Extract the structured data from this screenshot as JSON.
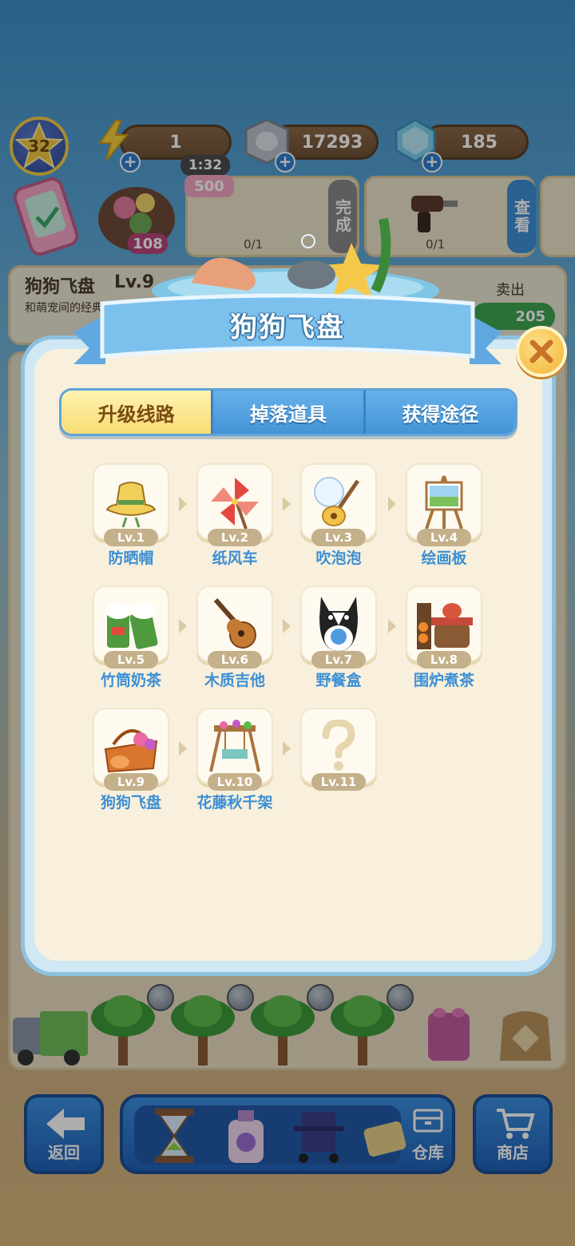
{
  "hud": {
    "player_level": "32",
    "energy": "1",
    "energy_timer": "1:32",
    "coins": "17293",
    "gems": "185"
  },
  "background": {
    "order_badge": "500",
    "order_count_1": "0/1",
    "order_count_2": "0/1",
    "order_complete_label": "完成",
    "order_view_label": "查看",
    "event_count": "108",
    "item_title": "狗狗飞盘",
    "item_level": "Lv.9",
    "item_desc": "和萌宠间的经典互动玩",
    "sell_label": "卖出",
    "sell_price": "205"
  },
  "bottom_nav": {
    "back_label": "返回",
    "warehouse_label": "仓库",
    "shop_label": "商店"
  },
  "modal": {
    "title": "狗狗飞盘",
    "tabs": [
      {
        "label": "升级线路",
        "active": true
      },
      {
        "label": "掉落道具",
        "active": false
      },
      {
        "label": "获得途径",
        "active": false
      }
    ],
    "items": [
      {
        "level": "Lv.1",
        "name": "防晒帽",
        "icon": "sun-hat-icon"
      },
      {
        "level": "Lv.2",
        "name": "纸风车",
        "icon": "pinwheel-icon"
      },
      {
        "level": "Lv.3",
        "name": "吹泡泡",
        "icon": "bubble-wand-icon"
      },
      {
        "level": "Lv.4",
        "name": "绘画板",
        "icon": "easel-icon"
      },
      {
        "level": "Lv.5",
        "name": "竹筒奶茶",
        "icon": "bamboo-milk-tea-icon"
      },
      {
        "level": "Lv.6",
        "name": "木质吉他",
        "icon": "guitar-icon"
      },
      {
        "level": "Lv.7",
        "name": "野餐盒",
        "icon": "dog-icon"
      },
      {
        "level": "Lv.8",
        "name": "围炉煮茶",
        "icon": "stove-tea-icon"
      },
      {
        "level": "Lv.9",
        "name": "狗狗飞盘",
        "icon": "picnic-basket-icon"
      },
      {
        "level": "Lv.10",
        "name": "花藤秋千架",
        "icon": "flower-swing-icon"
      },
      {
        "level": "Lv.11",
        "name": "",
        "icon": "question-mark-icon"
      }
    ]
  }
}
